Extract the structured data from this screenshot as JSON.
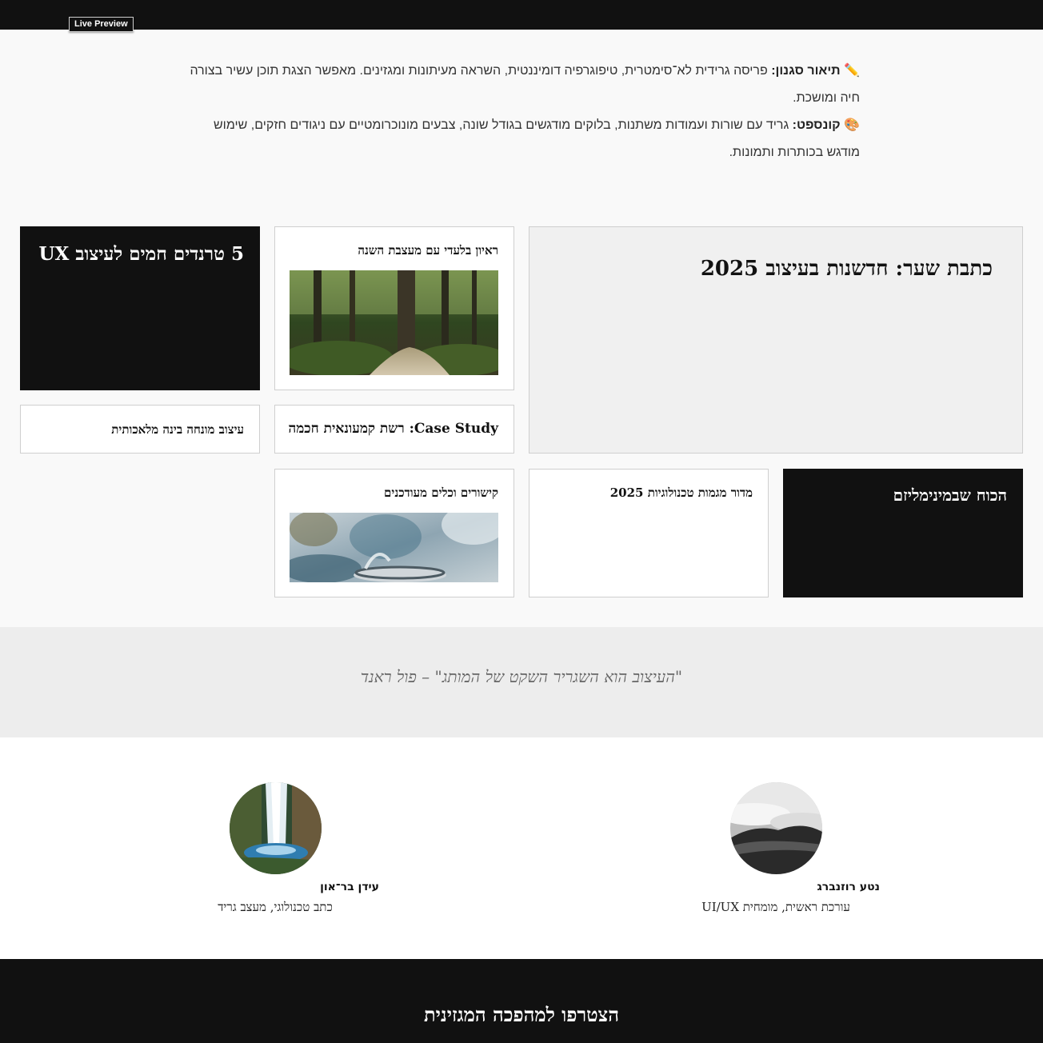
{
  "topbar": {
    "badge": "Live Preview"
  },
  "intro": {
    "style_icon": "✏️",
    "style_label": "תיאור סגנון:",
    "style_text": " פריסה גרידית לא־סימטרית, טיפוגרפיה דומיננטית, השראה מעיתונות ומגזינים. מאפשר הצגת תוכן עשיר בצורה חיה ומושכת.",
    "concept_icon": "🎨",
    "concept_label": "קונספט:",
    "concept_text": " גריד עם שורות ועמודות משתנות, בלוקים מודגשים בגודל שונה, צבעים מונוכרומטיים עם ניגודים חזקים, שימוש מודגש בכותרות ותמונות."
  },
  "cards": {
    "cover": "כתבת שער: חדשנות בעיצוב 2025",
    "interview": "ראיון בלעדי עם מעצבת השנה",
    "trends": "5 טרנדים חמים לעיצוב UX",
    "case_study": "Case Study: רשת קמעונאית חכמה",
    "ai_design": "עיצוב מונחה בינה מלאכותית",
    "minimalism": "הכוח שבמינימליזם",
    "tech_trends": "מדור מגמות טכנולוגיות 2025",
    "links": "קישורים וכלים מעודכנים"
  },
  "quote": "\"העיצוב הוא השגריר השקט של המותג\" – פול ראנד",
  "team": [
    {
      "name": "נטע רוזנברג",
      "role": "עורכת ראשית, מומחית UI/UX"
    },
    {
      "name": "עידן בר־און",
      "role": "כתב טכנולוגי, מעצב גריד"
    }
  ],
  "footer": {
    "title": "הצטרפו למהפכה המגזינית"
  }
}
